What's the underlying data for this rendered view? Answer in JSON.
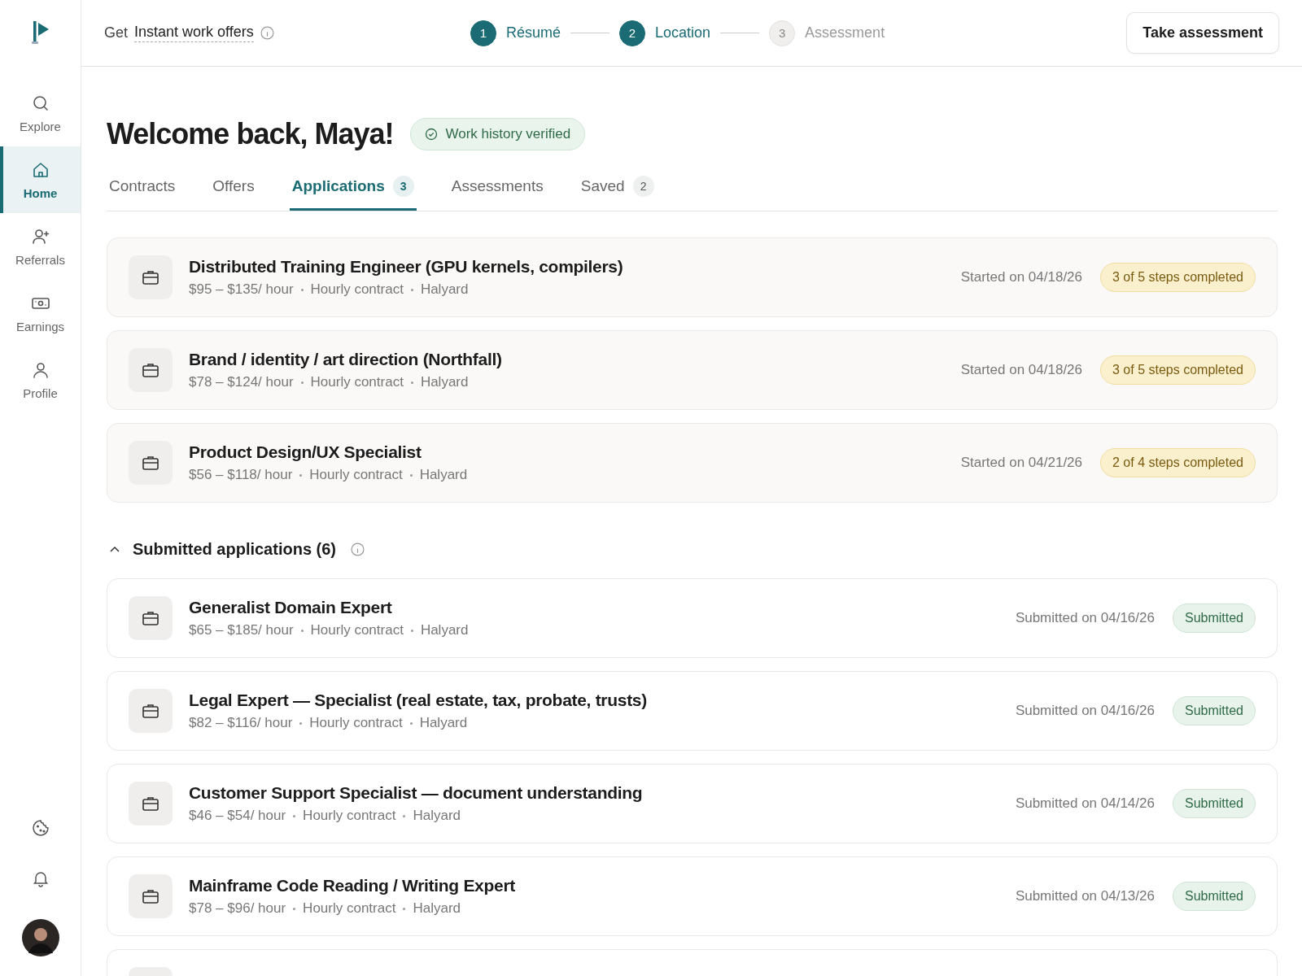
{
  "sidebar": {
    "items": [
      {
        "label": "Explore",
        "selected": false
      },
      {
        "label": "Home",
        "selected": true
      },
      {
        "label": "Referrals",
        "selected": false
      },
      {
        "label": "Earnings",
        "selected": false
      },
      {
        "label": "Profile",
        "selected": false
      }
    ]
  },
  "top_bar": {
    "prompt_prefix": "Get",
    "prompt_link": "Instant work offers",
    "steps": [
      {
        "number": "1",
        "label": "Résumé",
        "completed": true
      },
      {
        "number": "2",
        "label": "Location",
        "completed": true
      },
      {
        "number": "3",
        "label": "Assessment",
        "completed": false
      }
    ],
    "action_button": "Take assessment"
  },
  "heading": "Welcome back, Maya!",
  "verified_badge": "Work history verified",
  "tabs": [
    {
      "label": "Contracts",
      "selected": false
    },
    {
      "label": "Offers",
      "selected": false
    },
    {
      "label": "Applications",
      "count": "3",
      "selected": true
    },
    {
      "label": "Assessments",
      "selected": false
    },
    {
      "label": "Saved",
      "count": "2",
      "selected": false
    }
  ],
  "in_progress": [
    {
      "title": "Distributed Training Engineer (GPU kernels, compilers)",
      "rate": "$95 – $135/ hour",
      "type": "Hourly contract",
      "company": "Halyard",
      "date": "Started on 04/18/26",
      "status": "3 of 5 steps completed",
      "kind": "progress"
    },
    {
      "title": "Brand / identity / art direction (Northfall)",
      "rate": "$78 – $124/ hour",
      "type": "Hourly contract",
      "company": "Halyard",
      "date": "Started on 04/18/26",
      "status": "3 of 5 steps completed",
      "kind": "progress"
    },
    {
      "title": "Product Design/UX Specialist",
      "rate": "$56 – $118/ hour",
      "type": "Hourly contract",
      "company": "Halyard",
      "date": "Started on 04/21/26",
      "status": "2 of 4 steps completed",
      "kind": "progress"
    }
  ],
  "submitted": {
    "title": "Submitted applications (6)",
    "expanded": true,
    "items": [
      {
        "title": "Generalist Domain Expert",
        "rate": "$65 – $185/ hour",
        "type": "Hourly contract",
        "company": "Halyard",
        "date": "Submitted on 04/16/26",
        "status": "Submitted",
        "kind": "submitted"
      },
      {
        "title": "Legal Expert — Specialist (real estate, tax, probate, trusts)",
        "rate": "$82 – $116/ hour",
        "type": "Hourly contract",
        "company": "Halyard",
        "date": "Submitted on 04/16/26",
        "status": "Submitted",
        "kind": "submitted"
      },
      {
        "title": "Customer Support Specialist — document understanding",
        "rate": "$46 – $54/ hour",
        "type": "Hourly contract",
        "company": "Halyard",
        "date": "Submitted on 04/14/26",
        "status": "Submitted",
        "kind": "submitted"
      },
      {
        "title": "Mainframe Code Reading / Writing Expert",
        "rate": "$78 – $96/ hour",
        "type": "Hourly contract",
        "company": "Halyard",
        "date": "Submitted on 04/13/26",
        "status": "Submitted",
        "kind": "submitted"
      },
      {
        "kind": "submitted"
      }
    ]
  }
}
